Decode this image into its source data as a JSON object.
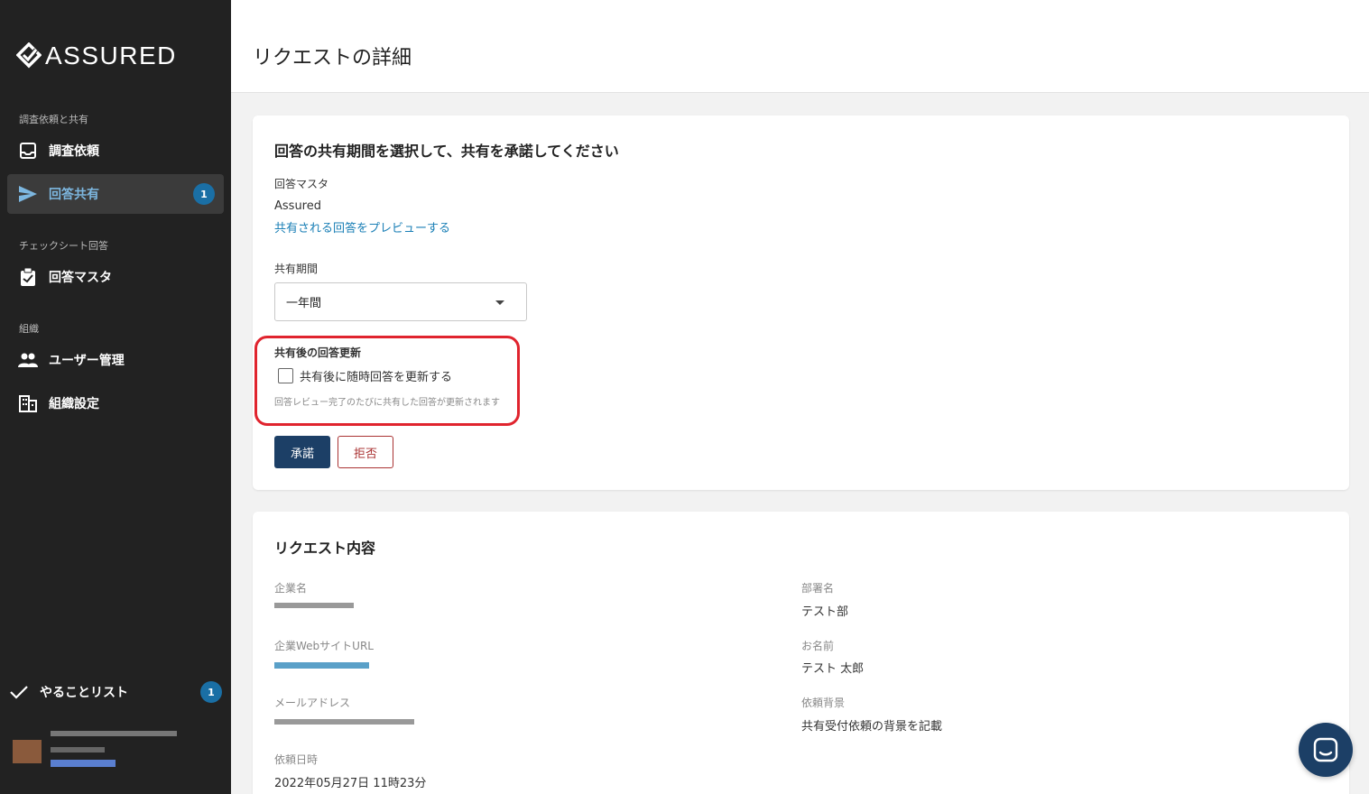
{
  "brand": {
    "name": "ASSURED"
  },
  "sidebar": {
    "sections": [
      {
        "label": "調査依頼と共有"
      },
      {
        "label": "チェックシート回答"
      },
      {
        "label": "組織"
      }
    ],
    "items": [
      {
        "label": "調査依頼",
        "icon": "inbox-icon"
      },
      {
        "label": "回答共有",
        "icon": "send-icon",
        "badge": "1",
        "active": true
      },
      {
        "label": "回答マスタ",
        "icon": "clipboard-check-icon"
      },
      {
        "label": "ユーザー管理",
        "icon": "people-icon"
      },
      {
        "label": "組織設定",
        "icon": "building-icon"
      }
    ],
    "todo": {
      "label": "やることリスト",
      "badge": "1"
    }
  },
  "header": {
    "title": "リクエストの詳細"
  },
  "share_card": {
    "title": "回答の共有期間を選択して、共有を承諾してください",
    "master_label": "回答マスタ",
    "master_value": "Assured",
    "preview_link": "共有される回答をプレビューする",
    "period_label": "共有期間",
    "period_value": "一年間",
    "update_label": "共有後の回答更新",
    "update_checkbox_label": "共有後に随時回答を更新する",
    "update_hint": "回答レビュー完了のたびに共有した回答が更新されます",
    "accept_label": "承諾",
    "reject_label": "拒否"
  },
  "request_card": {
    "title": "リクエスト内容",
    "company_label": "企業名",
    "website_label": "企業WebサイトURL",
    "email_label": "メールアドレス",
    "date_label": "依頼日時",
    "date_value": "2022年05月27日 11時23分",
    "department_label": "部署名",
    "department_value": "テスト部",
    "name_label": "お名前",
    "name_value": "テスト 太郎",
    "background_label": "依頼背景",
    "background_value": "共有受付依頼の背景を記載"
  },
  "colors": {
    "sidebar_bg": "#222222",
    "accent": "#1a6fa5",
    "primary_button": "#1c3f66",
    "reject": "#aa3333",
    "highlight": "#e0242e"
  }
}
